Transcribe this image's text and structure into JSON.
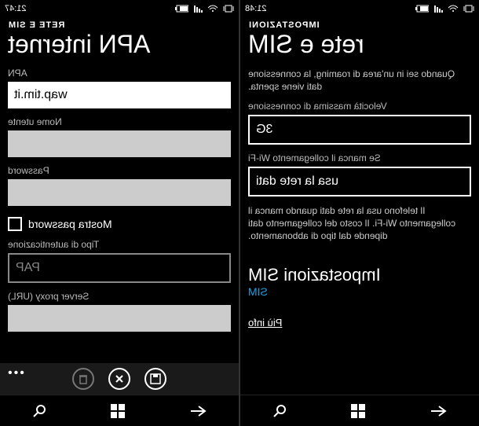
{
  "left": {
    "time": "21:47",
    "breadcrumb": "RETE E SIM",
    "title": "APN internet",
    "fields": {
      "apn_label": "APN",
      "apn_value": "wap.tim.it",
      "user_label": "Nome utente",
      "user_value": "",
      "pass_label": "Password",
      "pass_value": "",
      "show_pass": "Mostra password",
      "auth_label": "Tipo di autenticazione",
      "auth_value": "PAP",
      "proxy_label": "Server proxy (URL)",
      "proxy_value": ""
    },
    "appbar": {
      "save": "save",
      "cancel": "cancel",
      "delete": "delete"
    }
  },
  "right": {
    "time": "21:48",
    "breadcrumb": "IMPOSTAZIONI",
    "title": "rete e SIM",
    "roaming_desc": "Quando sei in un'area di roaming, la connessione dati viene spenta.",
    "speed_label": "Velocità massima di connessione",
    "speed_value": "3G",
    "wifi_label": "Se manca il collegamento Wi-Fi",
    "wifi_value": "usa la rete dati",
    "wifi_desc": "Il telefono usa la rete dati quando manca il collegamento Wi-Fi. Il costo del collegamento dati dipende dal tipo di abbonamento.",
    "sim_heading": "Impostazioni SIM",
    "sim_value": "SIM",
    "more_info": "Più info"
  },
  "nav": {
    "back": "back",
    "start": "start",
    "search": "search"
  },
  "status_icons": [
    "vibrate",
    "wifi",
    "signal",
    "battery"
  ]
}
